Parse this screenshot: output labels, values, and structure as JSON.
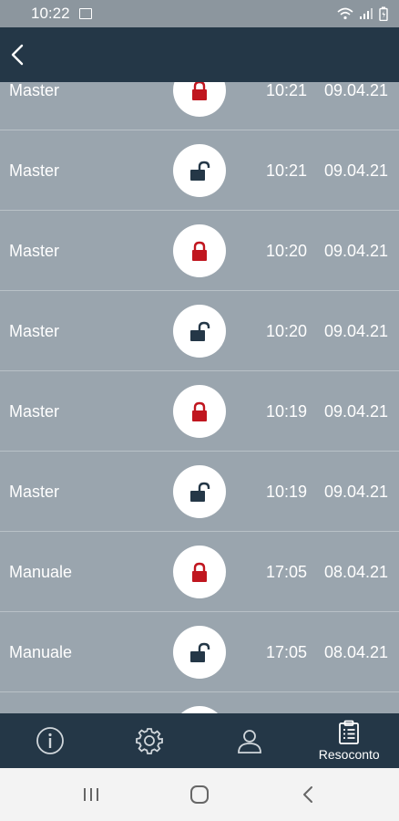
{
  "status_bar": {
    "time": "10:22",
    "icons": [
      "image-notification-icon",
      "wifi-icon",
      "signal-icon",
      "battery-icon"
    ]
  },
  "header": {
    "back_icon": "chevron-left-icon"
  },
  "colors": {
    "header_bg": "#243747",
    "list_bg": "#9aa5ae",
    "locked": "#c0161f",
    "unlocked": "#243747"
  },
  "events": [
    {
      "name": "Master",
      "state": "locked",
      "time": "10:21",
      "date": "09.04.21"
    },
    {
      "name": "Master",
      "state": "unlocked",
      "time": "10:21",
      "date": "09.04.21"
    },
    {
      "name": "Master",
      "state": "locked",
      "time": "10:20",
      "date": "09.04.21"
    },
    {
      "name": "Master",
      "state": "unlocked",
      "time": "10:20",
      "date": "09.04.21"
    },
    {
      "name": "Master",
      "state": "locked",
      "time": "10:19",
      "date": "09.04.21"
    },
    {
      "name": "Master",
      "state": "unlocked",
      "time": "10:19",
      "date": "09.04.21"
    },
    {
      "name": "Manuale",
      "state": "locked",
      "time": "17:05",
      "date": "08.04.21"
    },
    {
      "name": "Manuale",
      "state": "unlocked",
      "time": "17:05",
      "date": "08.04.21"
    },
    {
      "name": "",
      "state": "locked",
      "time": "",
      "date": ""
    }
  ],
  "bottom_nav": {
    "items": [
      {
        "icon": "info-icon",
        "label": ""
      },
      {
        "icon": "gear-icon",
        "label": ""
      },
      {
        "icon": "user-icon",
        "label": ""
      },
      {
        "icon": "clipboard-icon",
        "label": "Resoconto"
      }
    ]
  },
  "system_nav": {
    "icons": [
      "recent-apps-icon",
      "home-icon",
      "back-icon"
    ]
  }
}
